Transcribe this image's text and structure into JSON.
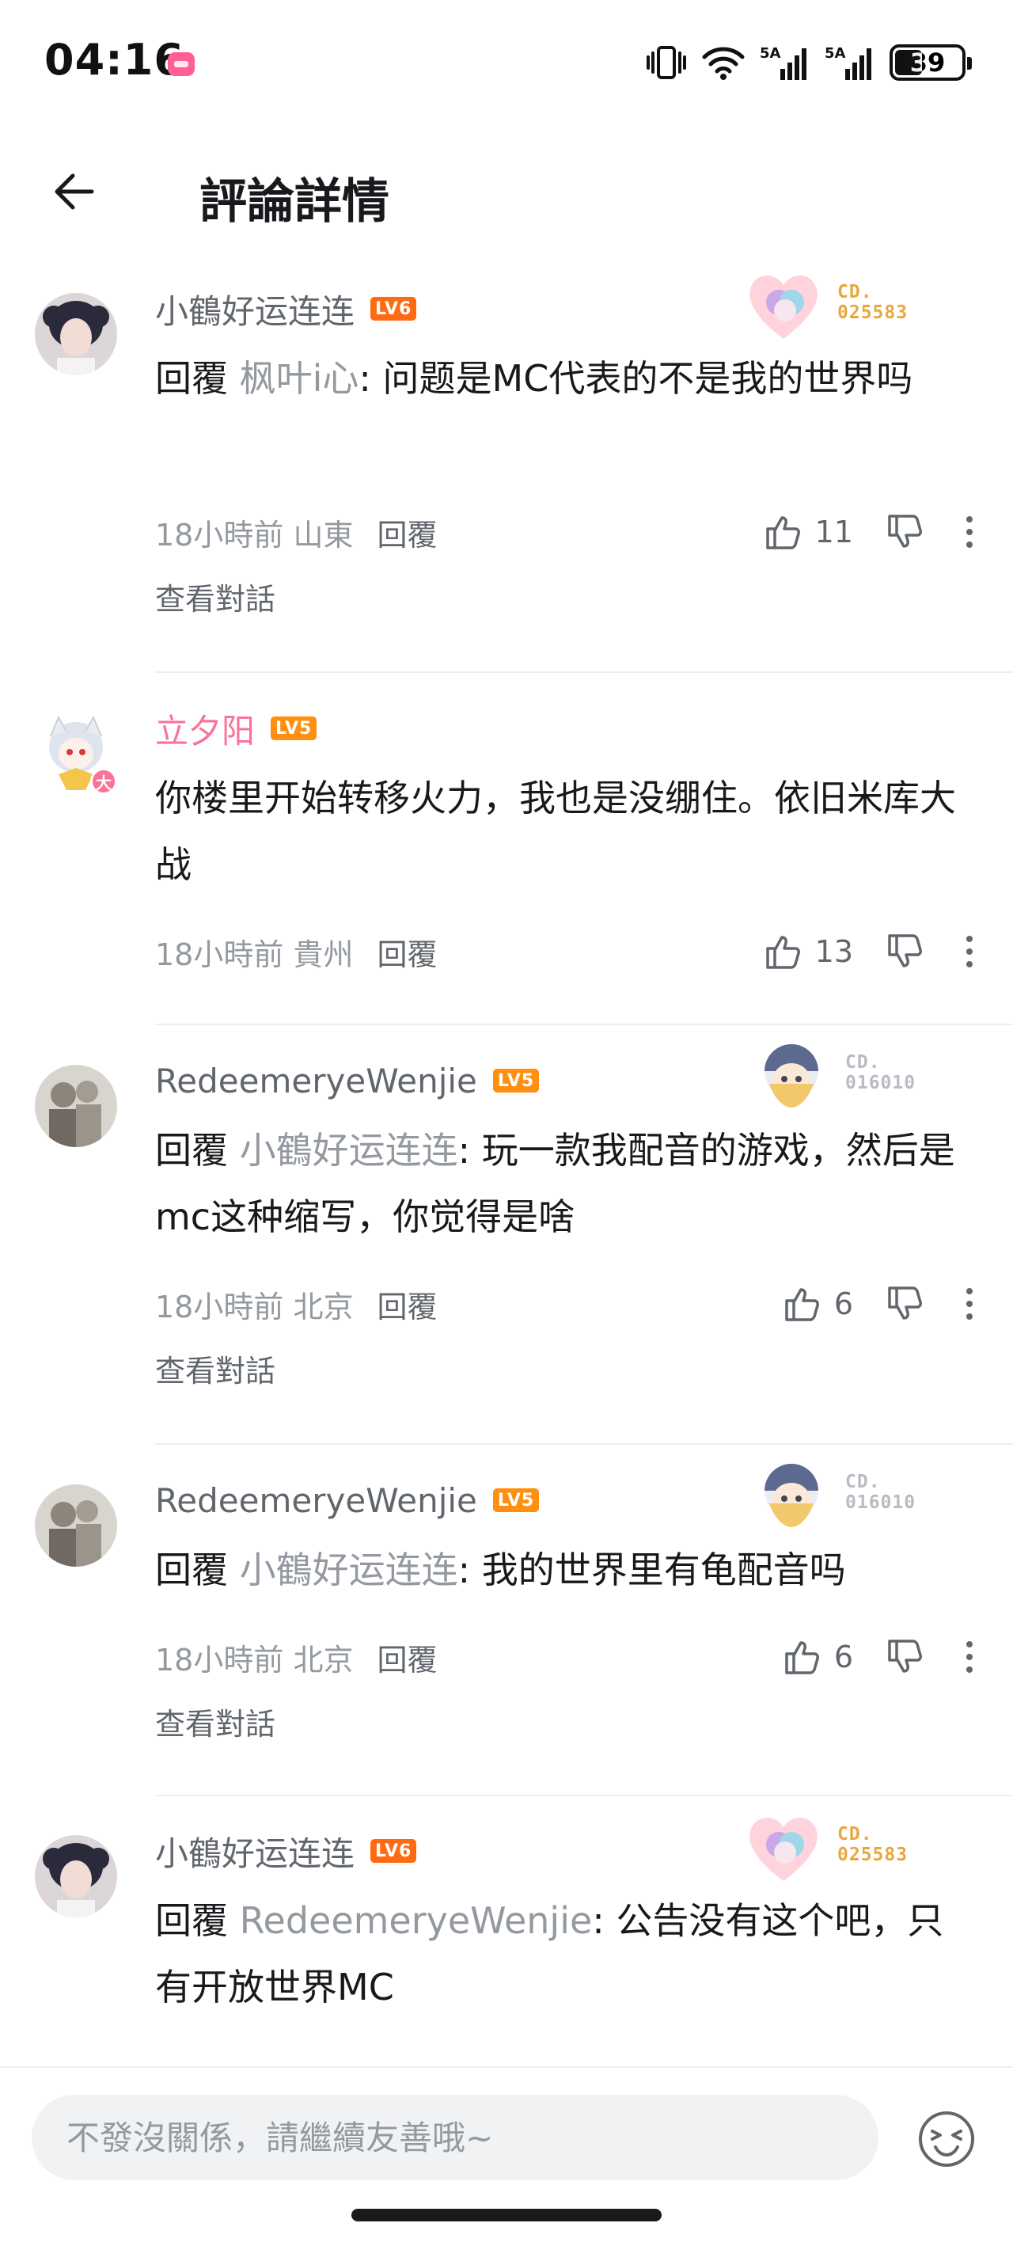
{
  "status_bar": {
    "time": "04:16",
    "network_1": "5A",
    "network_2": "5A",
    "battery": "39"
  },
  "header": {
    "title": "評論詳情",
    "back_icon": "arrow-left-icon"
  },
  "colors": {
    "pink": "#fb7299",
    "level_badge": "#ff6a13",
    "text_primary": "#18191c",
    "text_secondary": "#61666d",
    "text_tertiary": "#9499a0"
  },
  "comments": [
    {
      "username": "小鶴好运连连",
      "level": "LV6",
      "fan_card_no_top": "CD.",
      "fan_card_no": "025583",
      "reply_prefix": "回覆",
      "reply_target": "枫叶i心",
      "text": ": 问题是MC代表的不是我的世界吗",
      "time": "18小時前",
      "location": "山東",
      "reply_label": "回覆",
      "likes": "11",
      "view_conversation": "查看對話"
    },
    {
      "username": "立夕阳",
      "level": "LV5",
      "avatar_badge": "大",
      "text": "你楼里开始转移火力，我也是没绷住。依旧米库大战",
      "time": "18小時前",
      "location": "貴州",
      "reply_label": "回覆",
      "likes": "13"
    },
    {
      "username": "RedeemeryeWenjie",
      "level": "LV5",
      "fan_card_no_top": "CD.",
      "fan_card_no": "016010",
      "reply_prefix": "回覆",
      "reply_target": "小鶴好运连连",
      "text": ": 玩一款我配音的游戏，然后是mc这种缩写，你觉得是啥",
      "time": "18小時前",
      "location": "北京",
      "reply_label": "回覆",
      "likes": "6",
      "view_conversation": "查看對話"
    },
    {
      "username": "RedeemeryeWenjie",
      "level": "LV5",
      "fan_card_no_top": "CD.",
      "fan_card_no": "016010",
      "reply_prefix": "回覆",
      "reply_target": "小鶴好运连连",
      "text": ": 我的世界里有龟配音吗",
      "time": "18小時前",
      "location": "北京",
      "reply_label": "回覆",
      "likes": "6",
      "view_conversation": "查看對話"
    },
    {
      "username": "小鶴好运连连",
      "level": "LV6",
      "fan_card_no_top": "CD.",
      "fan_card_no": "025583",
      "reply_prefix": "回覆",
      "reply_target": "RedeemeryeWenjie",
      "text": ": 公告没有这个吧，只有开放世界MC"
    }
  ],
  "input": {
    "placeholder": "不發沒關係，請繼續友善哦~"
  }
}
